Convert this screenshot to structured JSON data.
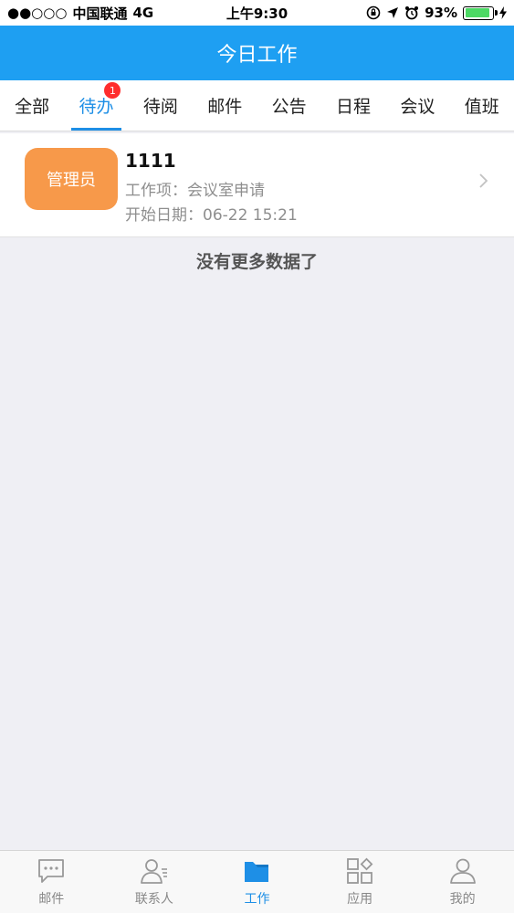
{
  "status_bar": {
    "signal": "●●○○○",
    "carrier": "中国联通",
    "network": "4G",
    "time": "上午9:30",
    "battery_percent": "93%",
    "battery_level": 0.93
  },
  "header": {
    "title": "今日工作"
  },
  "tabs": [
    {
      "label": "全部",
      "active": false
    },
    {
      "label": "待办",
      "active": true,
      "badge": "1"
    },
    {
      "label": "待阅",
      "active": false
    },
    {
      "label": "邮件",
      "active": false
    },
    {
      "label": "公告",
      "active": false
    },
    {
      "label": "日程",
      "active": false
    },
    {
      "label": "会议",
      "active": false
    },
    {
      "label": "值班",
      "active": false
    }
  ],
  "list": {
    "items": [
      {
        "avatar_text": "管理员",
        "title": "1111",
        "work_item": "工作项：会议室申请",
        "start_date": "开始日期：06-22 15:21"
      }
    ],
    "no_more_text": "没有更多数据了"
  },
  "bottom_nav": [
    {
      "label": "邮件",
      "icon": "chat-bubble-icon",
      "active": false
    },
    {
      "label": "联系人",
      "icon": "contacts-icon",
      "active": false
    },
    {
      "label": "工作",
      "icon": "folder-icon",
      "active": true
    },
    {
      "label": "应用",
      "icon": "apps-grid-icon",
      "active": false
    },
    {
      "label": "我的",
      "icon": "person-icon",
      "active": false
    }
  ],
  "colors": {
    "header_bg": "#1e9ff2",
    "accent": "#1e8fe6",
    "avatar_bg": "#f7994a",
    "badge": "#ff2d2d"
  }
}
